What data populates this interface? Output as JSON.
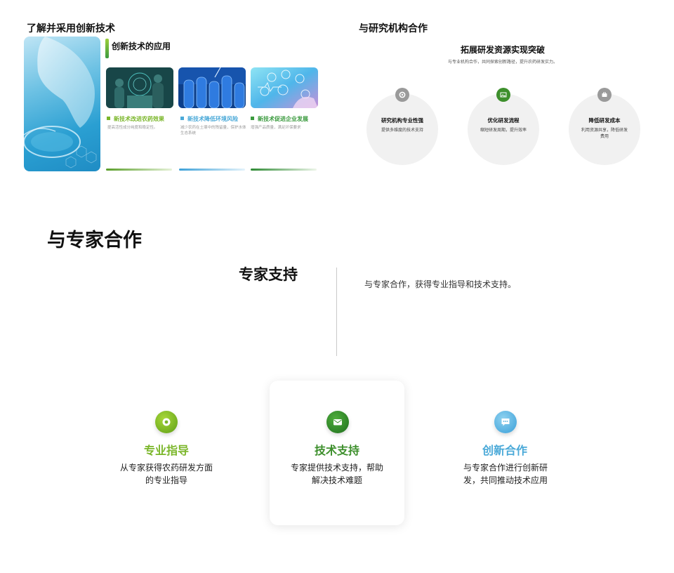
{
  "slide1": {
    "title": "了解并采用创新技术",
    "subtitle": "创新技术的应用",
    "cards": [
      {
        "title": "新技术改进农药效果",
        "desc": "提高活性成分纯度和稳定性。",
        "color": "#7ab629"
      },
      {
        "title": "新技术降低环境风险",
        "desc": "减少农药在土壤中的残留量，保护水体生态系统",
        "color": "#4aa9d8"
      },
      {
        "title": "新技术促进企业发展",
        "desc": "增强产品质量，满足环保要求",
        "color": "#3a9a3e"
      }
    ]
  },
  "slide2": {
    "title": "与研究机构合作",
    "heading": "拓展研发资源实现突破",
    "desc": "与专业机构合作，共同探索创新路径，提升农药研发实力。",
    "items": [
      {
        "title": "研究机构专业性强",
        "desc": "提供多维度的技术支持",
        "icon": "gear-icon",
        "color": "#9a9a9a"
      },
      {
        "title": "优化研发流程",
        "desc": "缩短研发周期，提升效率",
        "icon": "image-icon",
        "color": "#3d8f2c"
      },
      {
        "title": "降低研发成本",
        "desc": "利用资源共享，降低研发费用",
        "icon": "wallet-icon",
        "color": "#9a9a9a"
      }
    ]
  },
  "slide3": {
    "title": "与专家合作",
    "subtitle": "专家支持",
    "desc": "与专家合作，获得专业指导和技术支持。"
  },
  "slide4": {
    "columns": [
      {
        "title": "专业指导",
        "desc": "从专家获得农药研发方面的专业指导",
        "icon": "target-icon",
        "color": "#7ab629"
      },
      {
        "title": "技术支持",
        "desc": "专家提供技术支持，帮助解决技术难题",
        "icon": "mail-icon",
        "color": "#3d8f2c"
      },
      {
        "title": "创新合作",
        "desc": "与专家合作进行创新研发，共同推动技术应用",
        "icon": "chat-icon",
        "color": "#4aa9d8"
      }
    ]
  }
}
